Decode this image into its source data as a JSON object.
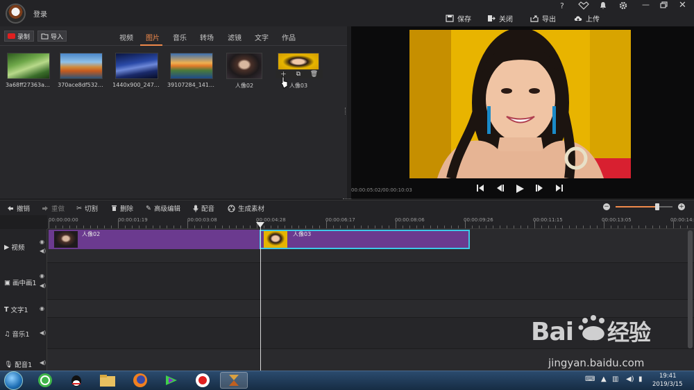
{
  "topbar": {
    "login": "登录",
    "help": "?",
    "vip": "VIP",
    "actions": [
      {
        "icon": "save-icon",
        "label": "保存"
      },
      {
        "icon": "close-file-icon",
        "label": "关闭"
      },
      {
        "icon": "export-icon",
        "label": "导出"
      },
      {
        "icon": "upload-icon",
        "label": "上传"
      }
    ]
  },
  "library": {
    "record_label": "录制",
    "import_label": "导入",
    "tabs": [
      "视频",
      "图片",
      "音乐",
      "转场",
      "滤镜",
      "文字",
      "作品"
    ],
    "active_tab": "图片",
    "items": [
      {
        "caption": "3a68ff27363a…",
        "thumb": "forest"
      },
      {
        "caption": "370ace8df532…",
        "thumb": "autumn-lake"
      },
      {
        "caption": "1440x900_247…",
        "thumb": "night-sky"
      },
      {
        "caption": "39107284_141…",
        "thumb": "sunset-coast"
      },
      {
        "caption": "人像02",
        "thumb": "portrait-dark"
      },
      {
        "caption": "人像03",
        "thumb": "portrait-yellow"
      }
    ]
  },
  "preview": {
    "timecode": "00:00:05:02/00:00:10:03"
  },
  "edit_toolbar": {
    "undo": "撤销",
    "redo": "重做",
    "cut": "切割",
    "delete": "删除",
    "advanced_edit": "高级编辑",
    "dubbing": "配音",
    "generate": "生成素材",
    "zoom_level": 0.73
  },
  "ruler": {
    "labels": [
      "00:00:00:00",
      "00:00:01:19",
      "00:00:03:08",
      "00:00:04:28",
      "00:00:06:17",
      "00:00:08:06",
      "00:00:09:26",
      "00:00:11:15",
      "00:00:13:05",
      "00:00:14:"
    ]
  },
  "tracks": {
    "video": "视频",
    "pip": "画中画1",
    "text": "文字1",
    "music": "音乐1",
    "voice": "配音1"
  },
  "clips": [
    {
      "label": "人像02",
      "selected": false
    },
    {
      "label": "人像03",
      "selected": true
    }
  ],
  "taskbar": {
    "time": "19:41",
    "date": "2019/3/15"
  },
  "watermark": {
    "brand": "Bai  经验",
    "url": "jingyan.baidu.com"
  },
  "colors": {
    "accent": "#f08a4b",
    "clip": "#6b3a8f",
    "selected_border": "#3ec9e8"
  }
}
